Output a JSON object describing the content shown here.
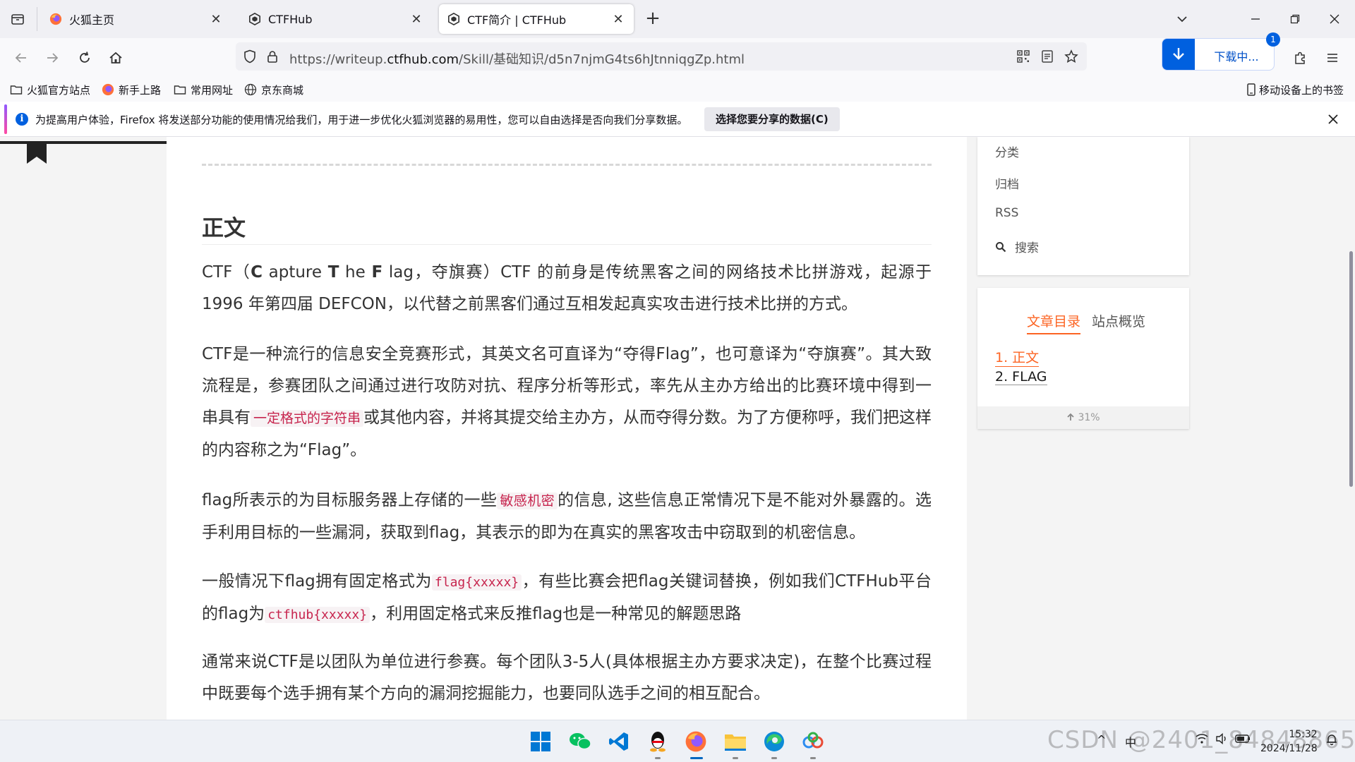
{
  "browser": {
    "tabs": [
      {
        "label": "火狐主页",
        "icon": "firefox-icon",
        "active": false
      },
      {
        "label": "CTFHub",
        "icon": "ctfhub-icon",
        "active": false
      },
      {
        "label": "CTF简介 | CTFHub",
        "icon": "ctfhub-icon",
        "active": true
      }
    ],
    "url_prefix": "https://writeup.",
    "url_domain": "ctfhub.com",
    "url_path": "/Skill/基础知识/d5n7njmG4ts6hJtnniqgZp.html",
    "download_label": "下载中...",
    "download_badge": "1"
  },
  "bookmarks": {
    "items": [
      "火狐官方站点",
      "新手上路",
      "常用网址",
      "京东商城"
    ],
    "mobile": "移动设备上的书签"
  },
  "notification": {
    "text": "为提高用户体验，Firefox 将发送部分功能的使用情况给我们，用于进一步优化火狐浏览器的易用性，您可以自由选择是否向我们分享数据。",
    "button": "选择您要分享的数据(C)"
  },
  "article": {
    "heading": "正文",
    "p1": {
      "a": "CTF（",
      "c": "C",
      "b": " apture ",
      "t": "T",
      "d": " he ",
      "f": "F",
      "e": " lag，夺旗赛）CTF 的前身是传统黑客之间的网络技术比拼游戏，起源于 1996 年第四届 DEFCON，以代替之前黑客们通过互相发起真实攻击进行技术比拼的方式。"
    },
    "p2": {
      "a": "CTF是一种流行的信息安全竞赛形式，其英文名可直译为“夺得Flag”，也可意译为“夺旗赛”。其大致流程是，参赛团队之间通过进行攻防对抗、程序分析等形式，率先从主办方给出的比赛环境中得到一串具有",
      "hl": "一定格式的字符串",
      "b": "或其他内容，并将其提交给主办方，从而夺得分数。为了方便称呼，我们把这样的内容称之为“Flag”。"
    },
    "p3": {
      "a": "flag所表示的为目标服务器上存储的一些",
      "hl": "敏感机密",
      "b": "的信息, 这些信息正常情况下是不能对外暴露的。选手利用目标的一些漏洞，获取到flag，其表示的即为在真实的黑客攻击中窃取到的机密信息。"
    },
    "p4": {
      "a": "一般情况下flag拥有固定格式为",
      "code1": "flag{xxxxx}",
      "b": "，有些比赛会把flag关键词替换，例如我们CTFHub平台的flag为",
      "code2": "ctfhub{xxxxx}",
      "c": "，利用固定格式来反推flag也是一种常见的解题思路"
    },
    "p5": "通常来说CTF是以团队为单位进行参赛。每个团队3-5人(具体根据主办方要求决定)，在整个比赛过程中既要每个选手拥有某个方向的漏洞挖掘能力，也要同队选手之间的相互配合。"
  },
  "sidebar": {
    "menu": [
      "分类",
      "归档",
      "RSS",
      "搜索"
    ],
    "tabs": [
      "文章目录",
      "站点概览"
    ],
    "toc": [
      "1. 正文",
      "2. FLAG"
    ],
    "progress": "31%",
    "progress_value": 31
  },
  "taskbar": {
    "icons": [
      "windows-start-icon",
      "wechat-icon",
      "vscode-icon",
      "qq-icon",
      "firefox-icon",
      "file-explorer-icon",
      "edge-icon",
      "baidu-netdisk-icon"
    ],
    "time": "15:32",
    "date": "2024/11/28",
    "watermark": "CSDN @2401_84848865"
  },
  "colors": {
    "accent": "#fc6423",
    "code_text": "#c7254e",
    "firefox_blue": "#0060df"
  }
}
